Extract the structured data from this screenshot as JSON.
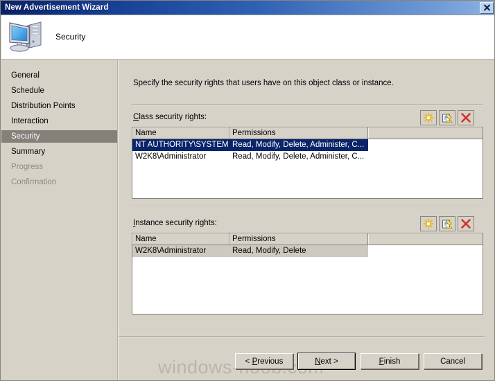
{
  "window": {
    "title": "New Advertisement Wizard",
    "close_label": "✕",
    "close_icon": "close-icon"
  },
  "header": {
    "title": "Security",
    "icon": "computer-icon"
  },
  "sidebar": {
    "items": [
      {
        "label": "General",
        "state": "normal"
      },
      {
        "label": "Schedule",
        "state": "normal"
      },
      {
        "label": "Distribution Points",
        "state": "normal"
      },
      {
        "label": "Interaction",
        "state": "normal"
      },
      {
        "label": "Security",
        "state": "selected"
      },
      {
        "label": "Summary",
        "state": "normal"
      },
      {
        "label": "Progress",
        "state": "disabled"
      },
      {
        "label": "Confirmation",
        "state": "disabled"
      }
    ]
  },
  "main": {
    "instruction": "Specify the security rights that users have on this object class or instance.",
    "class_group": {
      "label_accel": "C",
      "label_rest": "lass security rights:",
      "toolbar": [
        {
          "name": "new-icon",
          "tooltip": "New"
        },
        {
          "name": "properties-icon",
          "tooltip": "Properties"
        },
        {
          "name": "delete-icon",
          "tooltip": "Delete"
        }
      ],
      "columns": [
        "Name",
        "Permissions",
        ""
      ],
      "rows": [
        {
          "name": "NT AUTHORITY\\SYSTEM",
          "permissions": "Read, Modify, Delete, Administer, C...",
          "selected": "active"
        },
        {
          "name": "W2K8\\Administrator",
          "permissions": "Read, Modify, Delete, Administer, C...",
          "selected": "none"
        }
      ]
    },
    "instance_group": {
      "label_accel": "I",
      "label_rest": "nstance security rights:",
      "toolbar": [
        {
          "name": "new-icon",
          "tooltip": "New"
        },
        {
          "name": "properties-icon",
          "tooltip": "Properties"
        },
        {
          "name": "delete-icon",
          "tooltip": "Delete"
        }
      ],
      "columns": [
        "Name",
        "Permissions",
        ""
      ],
      "rows": [
        {
          "name": "W2K8\\Administrator",
          "permissions": "Read, Modify, Delete",
          "selected": "inactive"
        }
      ]
    }
  },
  "footer": {
    "buttons": [
      {
        "name": "previous-button",
        "pre": "< ",
        "accel": "P",
        "post": "revious",
        "default": false
      },
      {
        "name": "next-button",
        "pre": "",
        "accel": "N",
        "post": "ext >",
        "default": true
      },
      {
        "name": "finish-button",
        "pre": "",
        "accel": "F",
        "post": "inish",
        "default": false
      },
      {
        "name": "cancel-button",
        "pre": "",
        "accel": "",
        "post": "Cancel",
        "default": false
      }
    ]
  },
  "watermark": {
    "text": "windows-noob.com"
  },
  "colors": {
    "face": "#d6d2c8",
    "title_start": "#09206b",
    "title_end": "#8fb2e2",
    "selection_active": "#0a246a",
    "selection_inactive": "#cdc9c0",
    "nav_selected": "#84807a",
    "disabled_text": "#8d8a84"
  }
}
